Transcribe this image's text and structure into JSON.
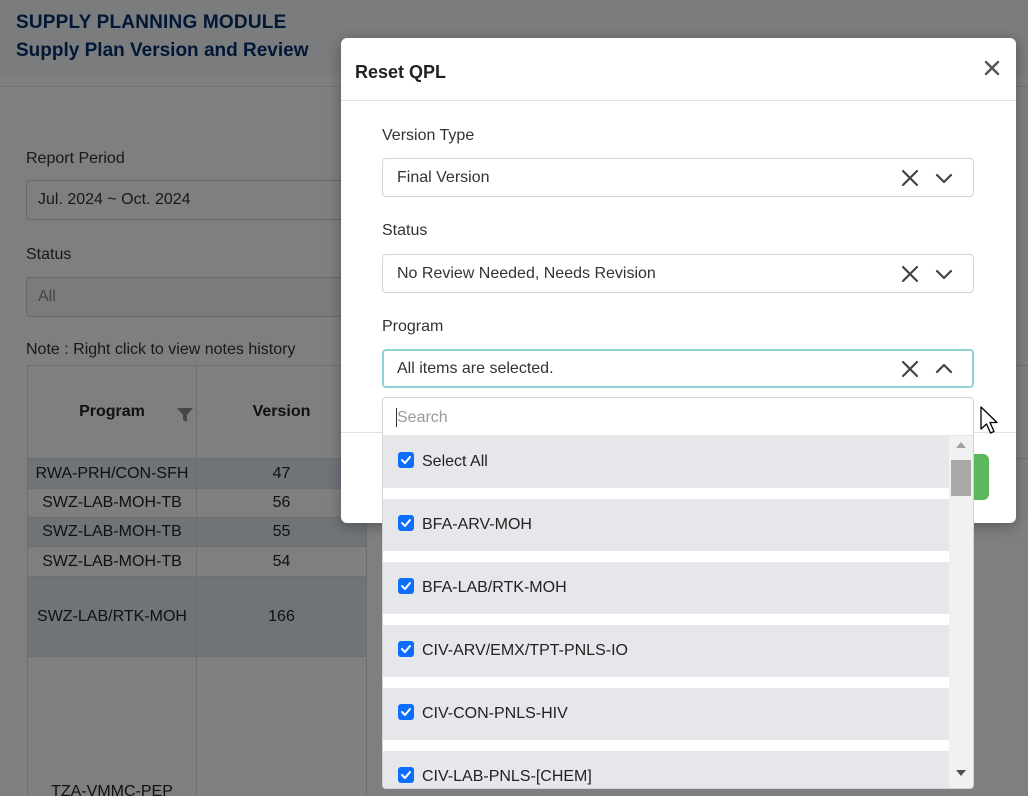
{
  "page": {
    "module_title": "SUPPLY PLANNING MODULE",
    "subtitle": "Supply Plan Version and Review",
    "report_period_label": "Report Period",
    "report_period_value": "Jul. 2024 ~ Oct. 2024",
    "status_label": "Status",
    "status_value": "All",
    "note": "Note : Right click to view notes history",
    "table": {
      "headers": [
        "Program",
        "Version"
      ],
      "rows": [
        {
          "program": "RWA-PRH/CON-SFH",
          "version": "47"
        },
        {
          "program": "SWZ-LAB-MOH-TB",
          "version": "56"
        },
        {
          "program": "SWZ-LAB-MOH-TB",
          "version": "55"
        },
        {
          "program": "SWZ-LAB-MOH-TB",
          "version": "54"
        },
        {
          "program": "SWZ-LAB/RTK-MOH",
          "version": "166"
        },
        {
          "program": "TZA-VMMC-PEP",
          "version": ""
        }
      ]
    }
  },
  "modal": {
    "title": "Reset QPL",
    "close_symbol": "×",
    "version_type": {
      "label": "Version Type",
      "value": "Final Version"
    },
    "status": {
      "label": "Status",
      "value": "No Review Needed, Needs Revision"
    },
    "program": {
      "label": "Program",
      "value": "All items are selected."
    }
  },
  "dropdown": {
    "search_placeholder": "Search",
    "items": [
      {
        "label": "Select All",
        "checked": true
      },
      {
        "label": "BFA-ARV-MOH",
        "checked": true
      },
      {
        "label": "BFA-LAB/RTK-MOH",
        "checked": true
      },
      {
        "label": "CIV-ARV/EMX/TPT-PNLS-IO",
        "checked": true
      },
      {
        "label": "CIV-CON-PNLS-HIV",
        "checked": true
      },
      {
        "label": "CIV-LAB-PNLS-[CHEM]",
        "checked": true
      }
    ]
  },
  "colors": {
    "title_blue": "#002f6c",
    "checkbox_blue": "#0d6efd",
    "focus_border": "#8fd3d6",
    "submit_green": "#5cb85c",
    "row_highlight": "#dfe8f2"
  },
  "icons": [
    "close-icon",
    "clear-icon",
    "chevron-down-icon",
    "chevron-up-icon",
    "filter-icon",
    "checkbox-checked-icon",
    "mouse-cursor-icon"
  ]
}
